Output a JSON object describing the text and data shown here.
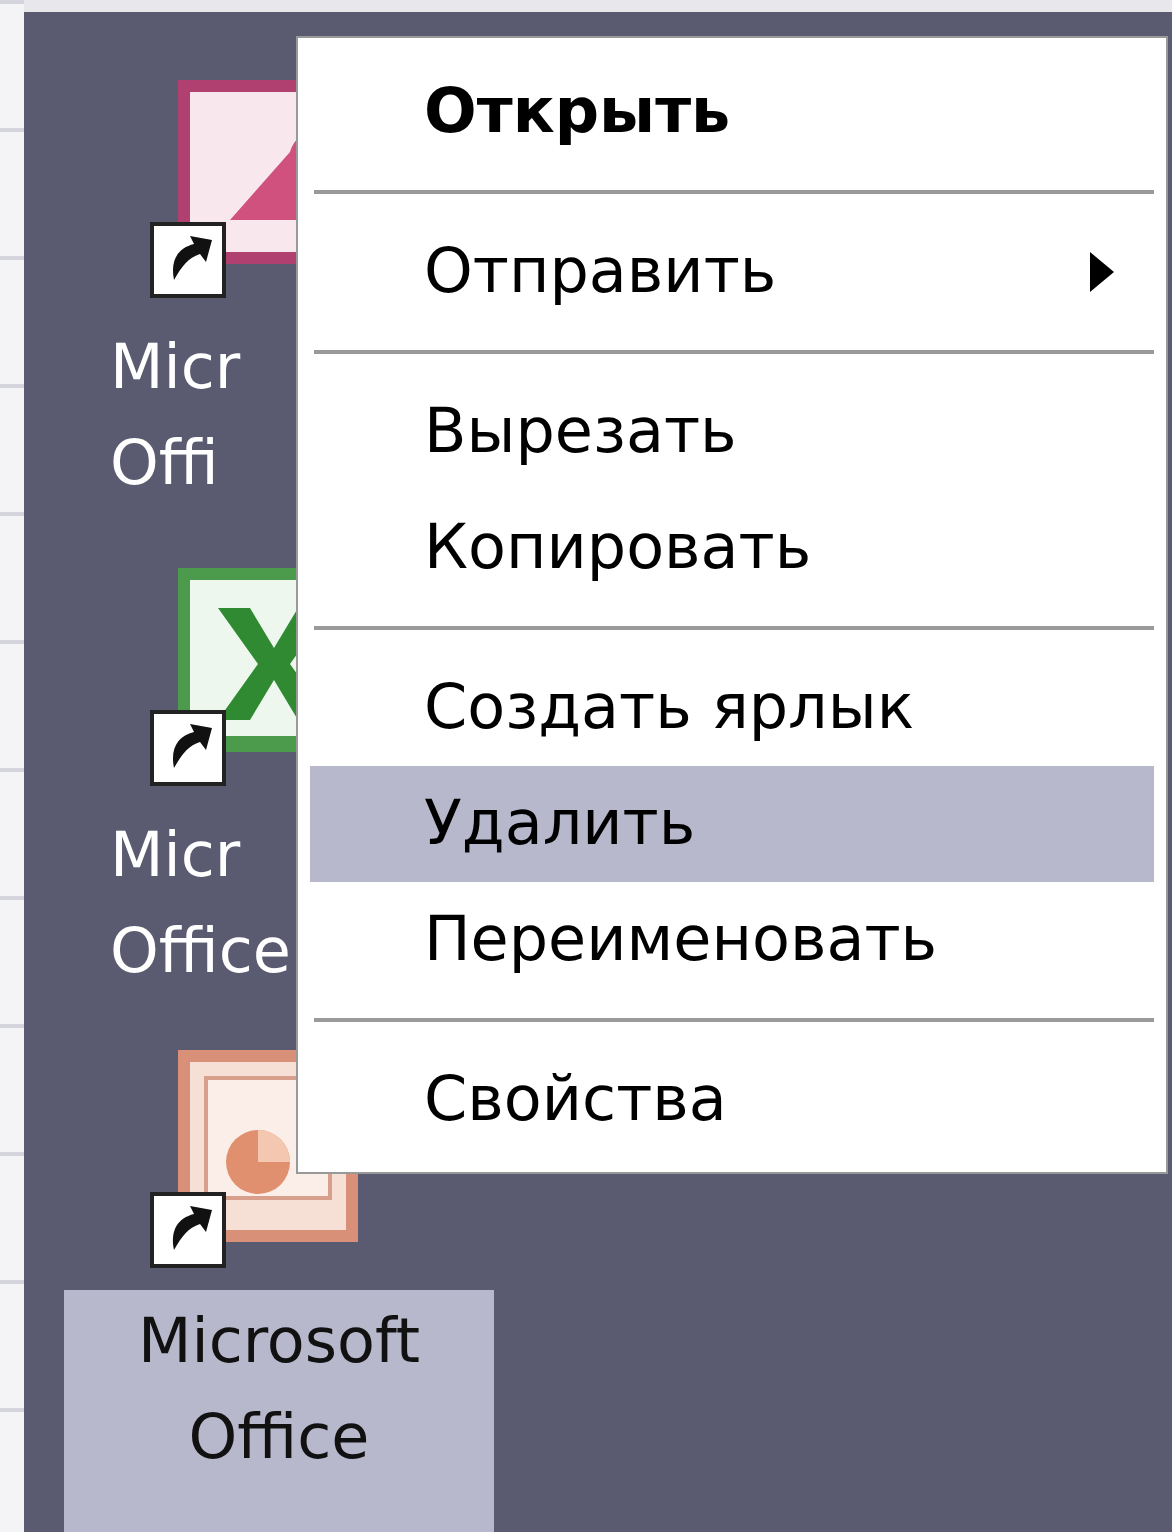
{
  "desktop_icons": [
    {
      "kind": "access",
      "label_lines": [
        "Micr",
        "Offi"
      ],
      "selected": false
    },
    {
      "kind": "excel",
      "label_lines": [
        "Micr",
        "Office"
      ],
      "selected": false
    },
    {
      "kind": "powerpoint",
      "label_lines": [
        "Microsoft",
        "Office"
      ],
      "selected": true
    }
  ],
  "context_menu": {
    "items": [
      {
        "kind": "item",
        "label": "Открыть",
        "default": true,
        "submenu": false,
        "selected": false
      },
      {
        "kind": "separator"
      },
      {
        "kind": "item",
        "label": "Отправить",
        "default": false,
        "submenu": true,
        "selected": false
      },
      {
        "kind": "separator"
      },
      {
        "kind": "item",
        "label": "Вырезать",
        "default": false,
        "submenu": false,
        "selected": false
      },
      {
        "kind": "item",
        "label": "Копировать",
        "default": false,
        "submenu": false,
        "selected": false
      },
      {
        "kind": "separator"
      },
      {
        "kind": "item",
        "label": "Создать ярлык",
        "default": false,
        "submenu": false,
        "selected": false
      },
      {
        "kind": "item",
        "label": "Удалить",
        "default": false,
        "submenu": false,
        "selected": true
      },
      {
        "kind": "item",
        "label": "Переименовать",
        "default": false,
        "submenu": false,
        "selected": false
      },
      {
        "kind": "separator"
      },
      {
        "kind": "item",
        "label": "Свойства",
        "default": false,
        "submenu": false,
        "selected": false
      }
    ]
  }
}
